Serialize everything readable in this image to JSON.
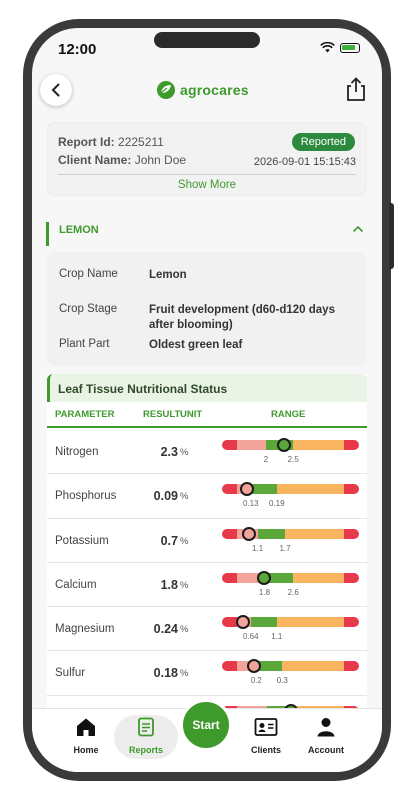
{
  "status_bar": {
    "time": "12:00"
  },
  "header": {
    "brand": "agrocares"
  },
  "report": {
    "id_label": "Report Id:",
    "id_value": "2225211",
    "client_label": "Client Name:",
    "client_value": "John Doe",
    "status": "Reported",
    "datetime": "2026-09-01 15:15:43",
    "show_more": "Show More"
  },
  "crop": {
    "section_title": "LEMON",
    "fields": [
      {
        "label": "Crop Name",
        "value": "Lemon"
      },
      {
        "label": "Crop Stage",
        "value": "Fruit development (d60-d120 days after blooming)"
      },
      {
        "label": "Plant Part",
        "value": "Oldest green leaf"
      }
    ]
  },
  "leaf_tissue": {
    "title": "Leaf Tissue Nutritional Status",
    "columns": {
      "parameter": "PARAMETER",
      "result": "RESULT",
      "unit": "UNIT",
      "range": "RANGE"
    },
    "rows": [
      {
        "name": "Nitrogen",
        "value": "2.3",
        "unit": "%",
        "low": "2",
        "high": "2.5",
        "marker": 0.45,
        "lowPos": 0.32,
        "highPos": 0.52
      },
      {
        "name": "Phosphorus",
        "value": "0.09",
        "unit": "%",
        "low": "0.13",
        "high": "0.19",
        "marker": 0.18,
        "lowPos": 0.21,
        "highPos": 0.4
      },
      {
        "name": "Potassium",
        "value": "0.7",
        "unit": "%",
        "low": "1.1",
        "high": "1.7",
        "marker": 0.2,
        "lowPos": 0.26,
        "highPos": 0.46
      },
      {
        "name": "Calcium",
        "value": "1.8",
        "unit": "%",
        "low": "1.8",
        "high": "2.6",
        "marker": 0.31,
        "lowPos": 0.31,
        "highPos": 0.52
      },
      {
        "name": "Magnesium",
        "value": "0.24",
        "unit": "%",
        "low": "0.64",
        "high": "1.1",
        "marker": 0.15,
        "lowPos": 0.21,
        "highPos": 0.4
      },
      {
        "name": "Sulfur",
        "value": "0.18",
        "unit": "%",
        "low": "0.2",
        "high": "0.3",
        "marker": 0.23,
        "lowPos": 0.25,
        "highPos": 0.44
      },
      {
        "name": "",
        "value": "",
        "unit": "",
        "low": "",
        "high": "",
        "marker": 0.5,
        "lowPos": 0.33,
        "highPos": 0.53
      }
    ]
  },
  "nav": {
    "home": "Home",
    "reports": "Reports",
    "start": "Start",
    "clients": "Clients",
    "account": "Account"
  },
  "colors": {
    "brand_green": "#3f9a2c",
    "range_red": "#e8394a",
    "range_low": "#f2a49b",
    "range_optimal": "#5aa83a",
    "range_high": "#f8b45f"
  }
}
